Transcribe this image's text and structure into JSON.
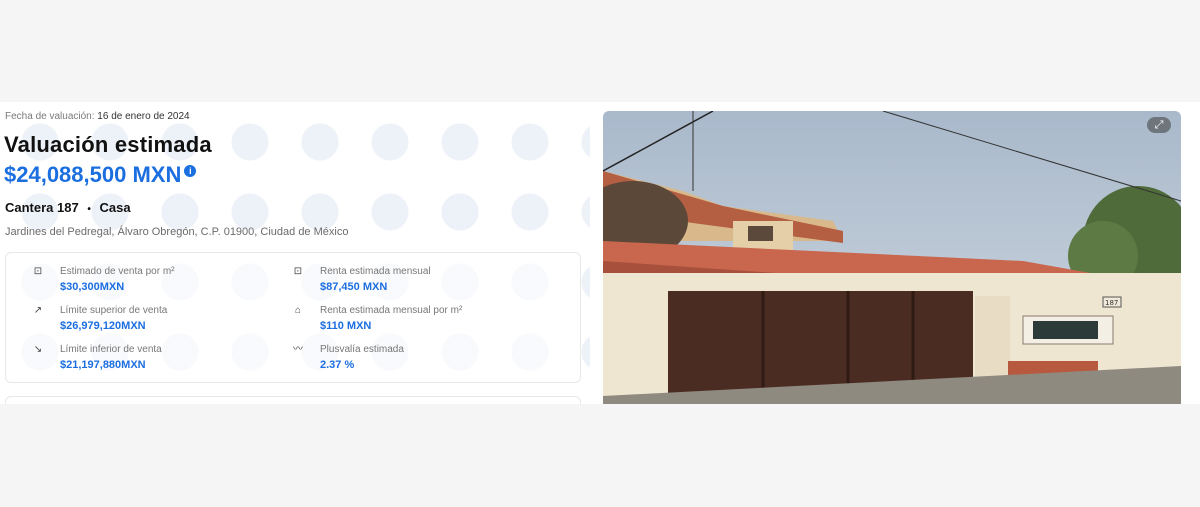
{
  "valuation": {
    "date_label": "Fecha de valuación:",
    "date_value": "16 de enero de 2024",
    "title": "Valuación estimada",
    "price": "$24,088,500 MXN",
    "info_symbol": "i",
    "property_name": "Cantera 187",
    "separator": "•",
    "property_type": "Casa",
    "address": "Jardines del Pedregal, Álvaro Obregón, C.P. 01900, Ciudad de México"
  },
  "stats": [
    {
      "icon": "scan-icon",
      "glyph": "⊡",
      "label": "Estimado de venta por m²",
      "value": "$30,300MXN"
    },
    {
      "icon": "scan-icon",
      "glyph": "⊡",
      "label": "Renta estimada mensual",
      "value": "$87,450 MXN"
    },
    {
      "icon": "trend-up-icon",
      "glyph": "↗",
      "label": "Límite superior de venta",
      "value": "$26,979,120MXN"
    },
    {
      "icon": "house-icon",
      "glyph": "⌂",
      "label": "Renta estimada mensual por m²",
      "value": "$110 MXN"
    },
    {
      "icon": "trend-down-icon",
      "glyph": "↘",
      "label": "Límite inferior de venta",
      "value": "$21,197,880MXN"
    },
    {
      "icon": "chart-line-icon",
      "glyph": "〰",
      "label": "Plusvalía estimada",
      "value": "2.37 %"
    }
  ],
  "photo": {
    "expand_glyph": "⤢",
    "house_number": "187"
  },
  "colors": {
    "accent": "#1b6ee0",
    "roof": "#c9674e",
    "gate": "#4a2c22",
    "sky": "#b8c6d6"
  }
}
